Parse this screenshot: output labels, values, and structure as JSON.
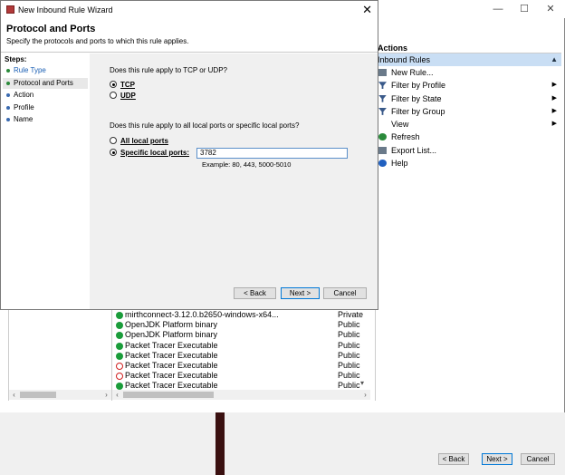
{
  "bg_window": {
    "controls": [
      "—",
      "☐",
      "✕"
    ],
    "actions": {
      "header": "Actions",
      "section": "Inbound Rules",
      "items": [
        {
          "label": "New Rule...",
          "icon": "new-rule-icon",
          "submenu": false
        },
        {
          "label": "Filter by Profile",
          "icon": "filter-icon",
          "submenu": true
        },
        {
          "label": "Filter by State",
          "icon": "filter-icon",
          "submenu": true
        },
        {
          "label": "Filter by Group",
          "icon": "filter-icon",
          "submenu": true
        },
        {
          "label": "View",
          "icon": "",
          "submenu": true
        },
        {
          "label": "Refresh",
          "icon": "refresh-icon",
          "submenu": false
        },
        {
          "label": "Export List...",
          "icon": "export-icon",
          "submenu": false
        },
        {
          "label": "Help",
          "icon": "help-icon",
          "submenu": false
        }
      ]
    },
    "rules": [
      {
        "name": "mirthconnect-3.12.0.b2650-windows-x64...",
        "profile": "Private",
        "status": "allow"
      },
      {
        "name": "OpenJDK Platform binary",
        "profile": "Public",
        "status": "allow"
      },
      {
        "name": "OpenJDK Platform binary",
        "profile": "Public",
        "status": "allow"
      },
      {
        "name": "Packet Tracer Executable",
        "profile": "Public",
        "status": "allow"
      },
      {
        "name": "Packet Tracer Executable",
        "profile": "Public",
        "status": "allow"
      },
      {
        "name": "Packet Tracer Executable",
        "profile": "Public",
        "status": "block"
      },
      {
        "name": "Packet Tracer Executable",
        "profile": "Public",
        "status": "block"
      },
      {
        "name": "Packet Tracer Executable",
        "profile": "Public",
        "status": "allow"
      }
    ]
  },
  "wizard2_buttons": {
    "back": "< Back",
    "next": "Next >",
    "cancel": "Cancel"
  },
  "wizard": {
    "title": "New Inbound Rule Wizard",
    "heading": "Protocol and Ports",
    "subheading": "Specify the protocols and ports to which this rule applies.",
    "steps_label": "Steps:",
    "steps": [
      "Rule Type",
      "Protocol and Ports",
      "Action",
      "Profile",
      "Name"
    ],
    "current_step": 1,
    "question_protocol": "Does this rule apply to TCP or UDP?",
    "protocol_options": [
      "TCP",
      "UDP"
    ],
    "protocol_selected": "TCP",
    "question_ports": "Does this rule apply to all local ports or specific local ports?",
    "port_options": [
      "All local ports",
      "Specific local ports:"
    ],
    "port_selected": "Specific local ports:",
    "ports_value": "3782",
    "ports_example": "Example: 80, 443, 5000-5010",
    "buttons": {
      "back": "< Back",
      "next": "Next >",
      "cancel": "Cancel"
    }
  },
  "colors": {
    "accent": "#0078d7",
    "section_bg": "#c9def4",
    "allow": "#1a9c3a",
    "block": "#d02020"
  }
}
